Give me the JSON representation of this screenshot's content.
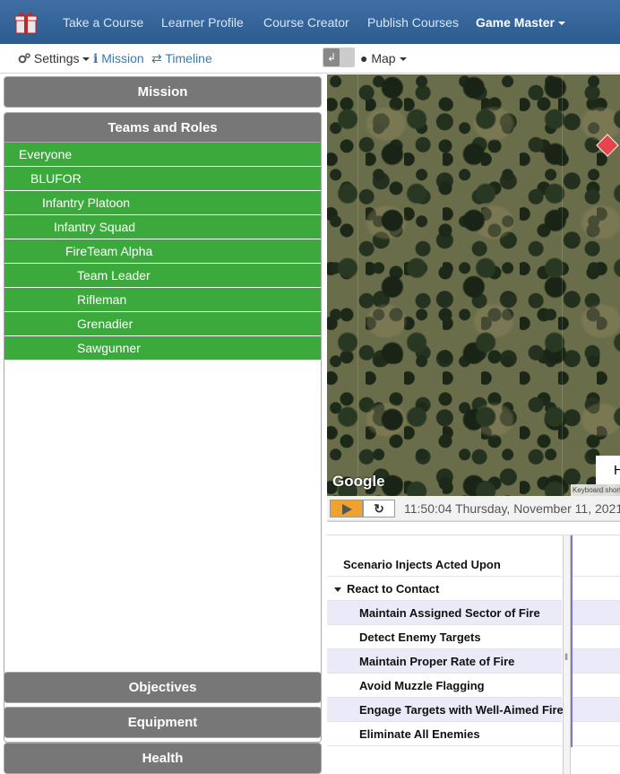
{
  "navbar": {
    "links": [
      "Take a Course",
      "Learner Profile",
      "Course Creator",
      "Publish Courses"
    ],
    "active_link": "Game Master",
    "bg_color": "#2c5b8f"
  },
  "toolbar": {
    "settings_label": "Settings",
    "mission_label": "Mission",
    "timeline_label": "Timeline",
    "map_label": "Map"
  },
  "left_panel": {
    "mission_header": "Mission",
    "teams_header": "Teams and Roles",
    "teams": [
      {
        "label": "Everyone",
        "level": 0
      },
      {
        "label": "BLUFOR",
        "level": 1
      },
      {
        "label": "Infantry Platoon",
        "level": 2
      },
      {
        "label": "Infantry Squad",
        "level": 3
      },
      {
        "label": "FireTeam Alpha",
        "level": 4
      },
      {
        "label": "Team Leader",
        "level": 5
      },
      {
        "label": "Rifleman",
        "level": 5
      },
      {
        "label": "Grenadier",
        "level": 5
      },
      {
        "label": "Sawgunner",
        "level": 5
      }
    ],
    "team_color": "#3ca93c",
    "objectives_header": "Objectives",
    "equipment_header": "Equipment",
    "health_header": "Health"
  },
  "map": {
    "attribution": "Google",
    "keyboard_text": "Keyboard shortcuts",
    "label_fragment": "H"
  },
  "playback": {
    "timestamp": "11:50:04 Thursday, November 11, 2021"
  },
  "timeline": {
    "rows": [
      {
        "label": "Scenario Injects Acted Upon",
        "indent": 0,
        "group": false
      },
      {
        "label": "React to Contact",
        "indent": 0,
        "group": true
      },
      {
        "label": "Maintain Assigned Sector of Fire",
        "indent": 1,
        "group": false
      },
      {
        "label": "Detect Enemy Targets",
        "indent": 1,
        "group": false
      },
      {
        "label": "Maintain Proper Rate of Fire",
        "indent": 1,
        "group": false
      },
      {
        "label": "Avoid Muzzle Flagging",
        "indent": 1,
        "group": false
      },
      {
        "label": "Engage Targets with Well-Aimed Fire",
        "indent": 1,
        "group": false
      },
      {
        "label": "Eliminate All Enemies",
        "indent": 1,
        "group": false
      }
    ]
  }
}
